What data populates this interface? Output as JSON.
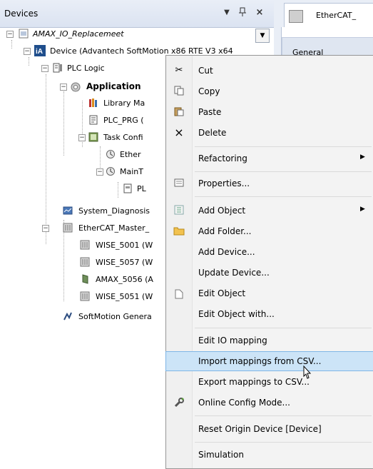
{
  "devices_panel": {
    "title": "Devices",
    "dropdown_glyph": "▼",
    "pin_glyph": "⊥",
    "close_glyph": "×"
  },
  "editor": {
    "tab_label": "EtherCAT_",
    "general_label": "General"
  },
  "tree": {
    "combo_glyph": "▼",
    "rows": {
      "project": "AMAX_IO_Replacemeet",
      "device": "Device (Advantech SoftMotion x86 RTE V3 x64",
      "plc_logic": "PLC Logic",
      "application": "Application",
      "library_manager": "Library Ma",
      "plc_prg": "PLC_PRG (",
      "task_config": "Task Confi",
      "ethercat_task": "Ether",
      "main_task": "MainT",
      "plc_call": "PL",
      "system_diagnosis": "System_Diagnosis",
      "ethercat_master": "EtherCAT_Master_",
      "wise_5001": "WISE_5001 (W",
      "wise_5057": "WISE_5057 (W",
      "amax_5056": "AMAX_5056 (A",
      "wise_5051": "WISE_5051 (W",
      "softmotion": "SoftMotion Genera"
    }
  },
  "context_menu": {
    "cut": "Cut",
    "copy": "Copy",
    "paste": "Paste",
    "delete": "Delete",
    "refactoring": "Refactoring",
    "properties": "Properties...",
    "add_object": "Add Object",
    "add_folder": "Add Folder...",
    "add_device": "Add Device...",
    "update_device": "Update Device...",
    "edit_object": "Edit Object",
    "edit_object_with": "Edit Object with...",
    "edit_io_mapping": "Edit IO mapping",
    "import_mappings": "Import mappings from CSV...",
    "export_mappings": "Export mappings to CSV...",
    "online_config": "Online Config Mode...",
    "reset_origin": "Reset Origin Device [Device]",
    "simulation": "Simulation",
    "submenu_arrow": "▶",
    "highlighted_item": "import_mappings"
  },
  "colors": {
    "highlight": "#cce4f7",
    "header_bg": "#dbe3f1",
    "device_badge": "#1f4e8c"
  }
}
